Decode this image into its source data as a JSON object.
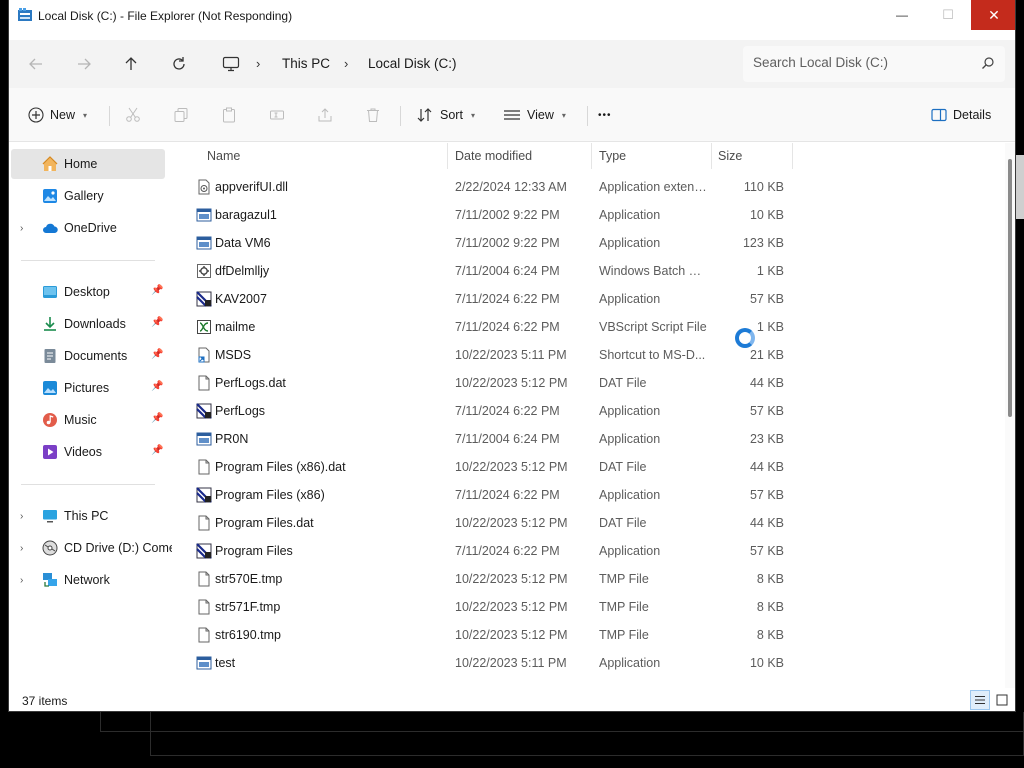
{
  "window": {
    "title": "Local Disk (C:) - File Explorer (Not Responding)"
  },
  "titlebar": {
    "minimize_glyph": "—",
    "maximize_glyph": "☐",
    "close_glyph": "✕"
  },
  "address": {
    "crumbs": [
      "This PC",
      "Local Disk (C:)"
    ],
    "search_placeholder": "Search Local Disk (C:)"
  },
  "commands": {
    "new_label": "New",
    "sort_label": "Sort",
    "view_label": "View",
    "more_label": "•••",
    "details_label": "Details"
  },
  "nav": {
    "items": [
      {
        "label": "Home",
        "icon": "home-icon",
        "selected": true
      },
      {
        "label": "Gallery",
        "icon": "gallery-icon"
      },
      {
        "label": "OneDrive",
        "icon": "cloud-icon",
        "expandable": true
      },
      {
        "label": "Desktop",
        "icon": "desktop-folder-icon",
        "pinned": true
      },
      {
        "label": "Downloads",
        "icon": "download-icon",
        "pinned": true
      },
      {
        "label": "Documents",
        "icon": "documents-icon",
        "pinned": true
      },
      {
        "label": "Pictures",
        "icon": "pictures-icon",
        "pinned": true
      },
      {
        "label": "Music",
        "icon": "music-icon",
        "pinned": true
      },
      {
        "label": "Videos",
        "icon": "videos-icon",
        "pinned": true
      },
      {
        "label": "This PC",
        "icon": "computer-icon",
        "expandable": true
      },
      {
        "label": "CD Drive (D:) Come",
        "icon": "cd-drive-icon",
        "expandable": true
      },
      {
        "label": "Network",
        "icon": "network-icon",
        "expandable": true
      }
    ]
  },
  "columns": {
    "name": "Name",
    "date": "Date modified",
    "type": "Type",
    "size": "Size"
  },
  "files": [
    {
      "name": "appverifUI.dll",
      "date": "2/22/2024 12:33 AM",
      "type": "Application extens...",
      "size": "110 KB",
      "icon": "dll-icon"
    },
    {
      "name": "baragazul1",
      "date": "7/11/2002 9:22 PM",
      "type": "Application",
      "size": "10 KB",
      "icon": "app-window-icon"
    },
    {
      "name": "Data VM6",
      "date": "7/11/2002 9:22 PM",
      "type": "Application",
      "size": "123 KB",
      "icon": "app-window-icon"
    },
    {
      "name": "dfDelmlljy",
      "date": "7/11/2004 6:24 PM",
      "type": "Windows Batch File",
      "size": "1 KB",
      "icon": "batch-file-icon"
    },
    {
      "name": "KAV2007",
      "date": "7/11/2024 6:22 PM",
      "type": "Application",
      "size": "57 KB",
      "icon": "app-installer-icon"
    },
    {
      "name": "mailme",
      "date": "7/11/2024 6:22 PM",
      "type": "VBScript Script File",
      "size": "1 KB",
      "icon": "script-file-icon"
    },
    {
      "name": "MSDS",
      "date": "10/22/2023 5:11 PM",
      "type": "Shortcut to MS-D...",
      "size": "21 KB",
      "icon": "shortcut-icon"
    },
    {
      "name": "PerfLogs.dat",
      "date": "10/22/2023 5:12 PM",
      "type": "DAT File",
      "size": "44 KB",
      "icon": "blank-file-icon"
    },
    {
      "name": "PerfLogs",
      "date": "7/11/2024 6:22 PM",
      "type": "Application",
      "size": "57 KB",
      "icon": "app-installer-icon"
    },
    {
      "name": "PR0N",
      "date": "7/11/2004 6:24 PM",
      "type": "Application",
      "size": "23 KB",
      "icon": "app-window-icon"
    },
    {
      "name": "Program Files (x86).dat",
      "date": "10/22/2023 5:12 PM",
      "type": "DAT File",
      "size": "44 KB",
      "icon": "blank-file-icon"
    },
    {
      "name": "Program Files (x86)",
      "date": "7/11/2024 6:22 PM",
      "type": "Application",
      "size": "57 KB",
      "icon": "app-installer-icon"
    },
    {
      "name": "Program Files.dat",
      "date": "10/22/2023 5:12 PM",
      "type": "DAT File",
      "size": "44 KB",
      "icon": "blank-file-icon"
    },
    {
      "name": "Program Files",
      "date": "7/11/2024 6:22 PM",
      "type": "Application",
      "size": "57 KB",
      "icon": "app-installer-icon"
    },
    {
      "name": "str570E.tmp",
      "date": "10/22/2023 5:12 PM",
      "type": "TMP File",
      "size": "8 KB",
      "icon": "blank-file-icon"
    },
    {
      "name": "str571F.tmp",
      "date": "10/22/2023 5:12 PM",
      "type": "TMP File",
      "size": "8 KB",
      "icon": "blank-file-icon"
    },
    {
      "name": "str6190.tmp",
      "date": "10/22/2023 5:12 PM",
      "type": "TMP File",
      "size": "8 KB",
      "icon": "blank-file-icon"
    },
    {
      "name": "test",
      "date": "10/22/2023 5:11 PM",
      "type": "Application",
      "size": "10 KB",
      "icon": "app-window-icon"
    }
  ],
  "status": {
    "item_count": "37 items"
  },
  "colors": {
    "close_red": "#c42b1c",
    "accent_blue": "#1d7bd6",
    "selection_gray": "#e5e5e5"
  }
}
